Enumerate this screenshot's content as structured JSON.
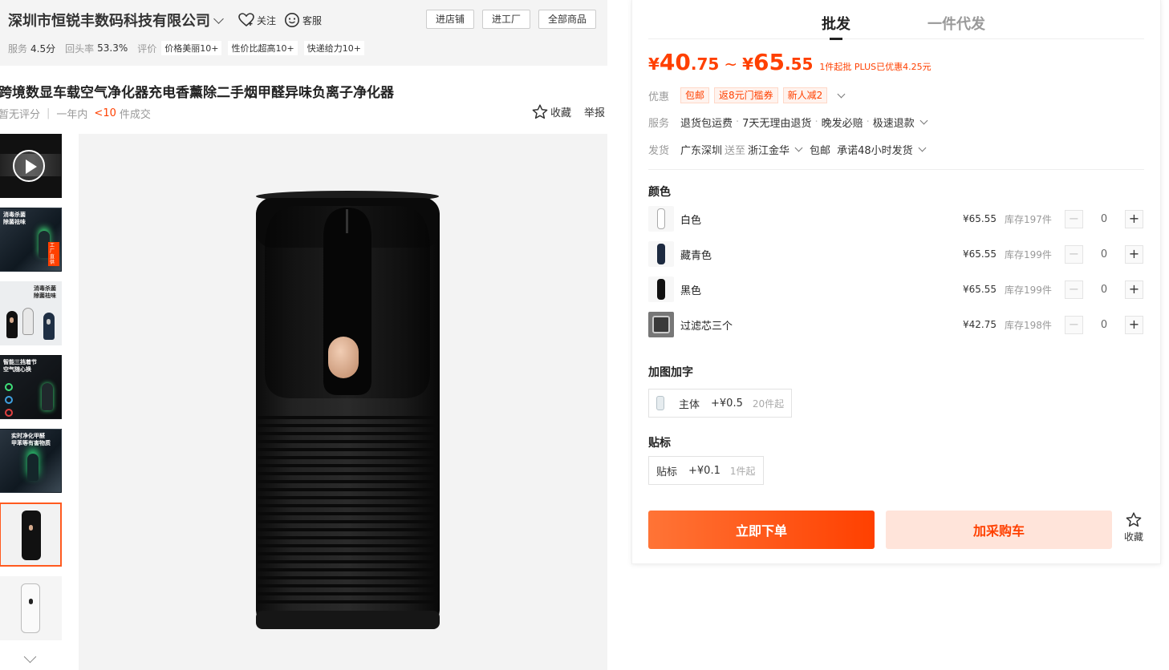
{
  "shop": {
    "name": "深圳市恒锐丰数码科技有限公司",
    "follow": "关注",
    "service": "客服",
    "buttons": [
      "进店铺",
      "进工厂",
      "全部商品"
    ],
    "stats": {
      "service_label": "服务",
      "service_value": "4.5分",
      "repeat_label": "回头率",
      "repeat_value": "53.3%",
      "review_label": "评价",
      "tags": [
        "价格美丽10+",
        "性价比超高10+",
        "快递给力10+"
      ]
    }
  },
  "product": {
    "title": "跨境数显车载空气净化器充电香薰除二手烟甲醛异味负离子净化器",
    "rating": "暂无评分",
    "period": "一年内",
    "sold_count": "<10",
    "sold_suffix": "件成交",
    "favorite": "收藏",
    "report": "举报"
  },
  "thumbnails": [
    {
      "kind": "video"
    },
    {
      "kind": "car",
      "caption": "消毒杀菌\n除菌祛味",
      "badge": "工厂直供"
    },
    {
      "kind": "light",
      "caption": "消毒杀菌\n除菌祛味"
    },
    {
      "kind": "car",
      "caption": "智能三挡着节\n空气随心换"
    },
    {
      "kind": "car",
      "caption": "实时净化甲醛\n甲苯等有害物质"
    },
    {
      "kind": "black",
      "active": true
    },
    {
      "kind": "white"
    }
  ],
  "panel": {
    "tabs": [
      "批发",
      "一件代发"
    ],
    "active_tab": 0,
    "price": {
      "low_cur": "¥",
      "low_int": "40",
      "low_dec": ".75",
      "tilde": "~",
      "high_cur": "¥",
      "high_int": "65",
      "high_dec": ".55",
      "note": "1件起批 PLUS已优惠4.25元"
    },
    "promo": {
      "label": "优惠",
      "coupons": [
        "包邮",
        "返8元门槛券",
        "新人减2"
      ]
    },
    "service": {
      "label": "服务",
      "items": [
        "退货包运费",
        "7天无理由退货",
        "晚发必赔",
        "极速退款"
      ]
    },
    "shipping": {
      "label": "发货",
      "from": "广东深圳",
      "to_word": "送至",
      "to": "浙江金华",
      "free": "包邮",
      "promise": "承诺48小时发货"
    },
    "color_title": "颜色",
    "skus": [
      {
        "name": "白色",
        "price": "¥65.55",
        "stock": "库存197件",
        "qty": "0",
        "style": "white"
      },
      {
        "name": "藏青色",
        "price": "¥65.55",
        "stock": "库存199件",
        "qty": "0",
        "style": "navy"
      },
      {
        "name": "黑色",
        "price": "¥65.55",
        "stock": "库存199件",
        "qty": "0",
        "style": "black"
      },
      {
        "name": "过滤芯三个",
        "price": "¥42.75",
        "stock": "库存198件",
        "qty": "0",
        "style": "filter"
      }
    ],
    "custom_title": "加图加字",
    "custom_option": {
      "name": "主体",
      "price": "+¥0.5",
      "min": "20件起"
    },
    "sticker_title": "贴标",
    "sticker_option": {
      "name": "贴标",
      "price": "+¥0.1",
      "min": "1件起"
    },
    "buy_now": "立即下单",
    "add_cart": "加采购车",
    "favorite": "收藏"
  },
  "colors": {
    "accent": "#ff4000",
    "accent_light": "#ffe4da",
    "header_bg": "#f4f4f4",
    "image_bg": "#f3f3f3"
  }
}
